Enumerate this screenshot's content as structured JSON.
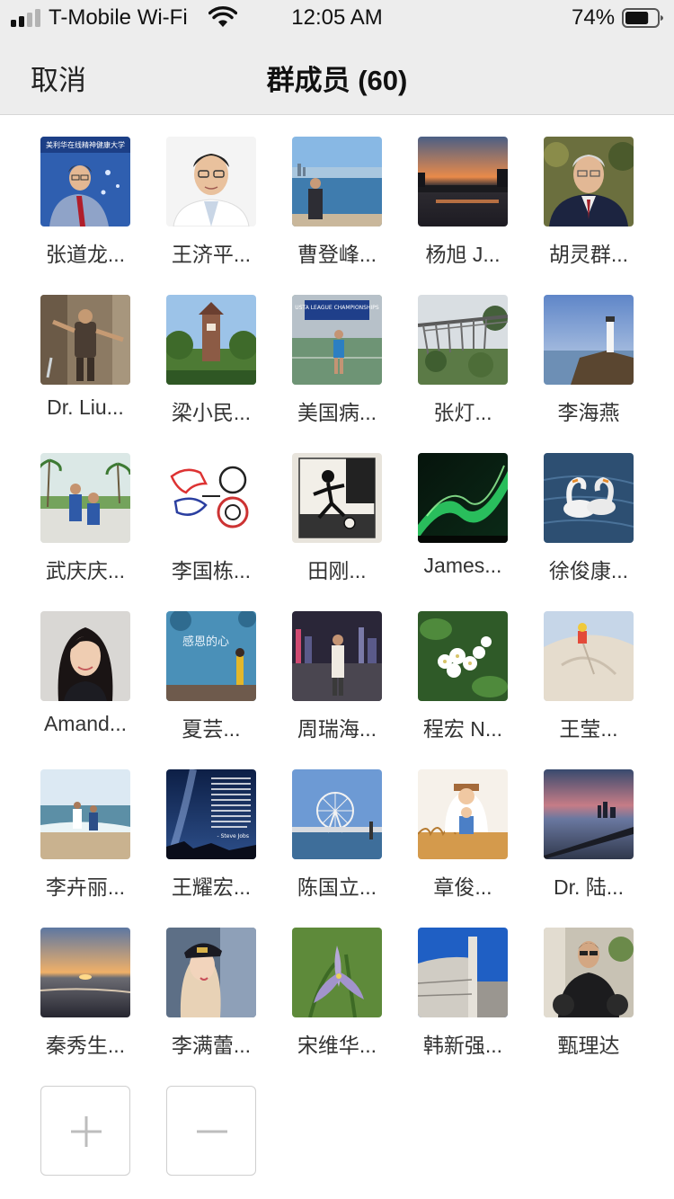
{
  "status_bar": {
    "carrier": "T-Mobile Wi-Fi",
    "time": "12:05 AM",
    "battery_percent": "74%",
    "battery_level": 0.74,
    "signal_bars_active": 2,
    "signal_bars_total": 4
  },
  "nav": {
    "cancel_label": "取消",
    "title": "群成员 (60)"
  },
  "members": [
    {
      "name": "张道龙...",
      "avatar": "professor-blue-banner",
      "banner_text": "美利华在线精神健康大学"
    },
    {
      "name": "王济平...",
      "avatar": "man-glasses-white-coat"
    },
    {
      "name": "曹登峰...",
      "avatar": "man-by-bay"
    },
    {
      "name": "杨旭 J...",
      "avatar": "sunset-lake"
    },
    {
      "name": "胡灵群...",
      "avatar": "man-suit-white-hair"
    },
    {
      "name": "Dr. Liu...",
      "avatar": "gladiator"
    },
    {
      "name": "梁小民...",
      "avatar": "tower-garden"
    },
    {
      "name": "美国病...",
      "avatar": "tennis-player",
      "banner_text": "USTA LEAGUE CHAMPIONSHIPS"
    },
    {
      "name": "张灯...",
      "avatar": "bridge-forest"
    },
    {
      "name": "李海燕",
      "avatar": "lighthouse-coast"
    },
    {
      "name": "武庆庆...",
      "avatar": "palm-mother-child"
    },
    {
      "name": "李国栋...",
      "avatar": "tiger-logo"
    },
    {
      "name": "田刚...",
      "avatar": "soccer-sketch"
    },
    {
      "name": "James...",
      "avatar": "aurora"
    },
    {
      "name": "徐俊康...",
      "avatar": "swans"
    },
    {
      "name": "Amand...",
      "avatar": "woman-portrait"
    },
    {
      "name": "夏芸...",
      "avatar": "chalk-wall-child",
      "banner_text": "感恩的心"
    },
    {
      "name": "周瑞海...",
      "avatar": "man-city-night"
    },
    {
      "name": "程宏 N...",
      "avatar": "white-flowers"
    },
    {
      "name": "王莹...",
      "avatar": "sand-child"
    },
    {
      "name": "李卉丽...",
      "avatar": "beach-kids"
    },
    {
      "name": "王耀宏...",
      "avatar": "milky-way-quote",
      "quote_attribution": "- Steve Jobs"
    },
    {
      "name": "陈国立...",
      "avatar": "ferris-wheel"
    },
    {
      "name": "章俊...",
      "avatar": "father-son-illustration"
    },
    {
      "name": "Dr. 陆...",
      "avatar": "city-shore-dusk"
    },
    {
      "name": "秦秀生...",
      "avatar": "sea-sunset"
    },
    {
      "name": "李满蕾...",
      "avatar": "woman-captain-hat"
    },
    {
      "name": "宋维华...",
      "avatar": "purple-iris"
    },
    {
      "name": "韩新强...",
      "avatar": "white-tower-blue-sky"
    },
    {
      "name": "甄理达",
      "avatar": "man-motorcycle"
    }
  ],
  "actions": {
    "add": "plus-icon",
    "remove": "minus-icon"
  },
  "colors": {
    "nav_background": "#ededed",
    "text_primary": "#111111",
    "button_border": "#cfcfcf",
    "button_icon": "#bdbdbd"
  }
}
